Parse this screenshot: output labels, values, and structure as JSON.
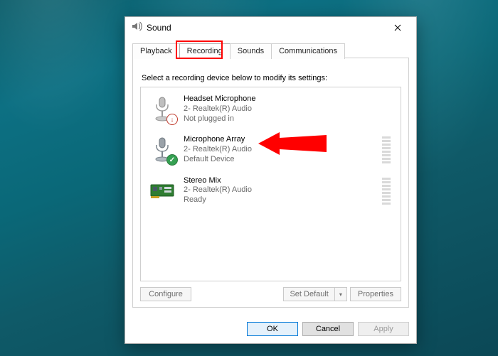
{
  "window": {
    "title": "Sound"
  },
  "tabs": {
    "items": [
      {
        "label": "Playback"
      },
      {
        "label": "Recording"
      },
      {
        "label": "Sounds"
      },
      {
        "label": "Communications"
      }
    ],
    "active_index": 1
  },
  "instruction": "Select a recording device below to modify its settings:",
  "devices": [
    {
      "name": "Headset Microphone",
      "desc": "2- Realtek(R) Audio",
      "status": "Not plugged in",
      "icon": "mic-icon",
      "badge": "error",
      "meter": false
    },
    {
      "name": "Microphone Array",
      "desc": "2- Realtek(R) Audio",
      "status": "Default Device",
      "icon": "mic-icon",
      "badge": "ok",
      "meter": true
    },
    {
      "name": "Stereo Mix",
      "desc": "2- Realtek(R) Audio",
      "status": "Ready",
      "icon": "card-icon",
      "badge": null,
      "meter": true
    }
  ],
  "actions": {
    "configure": "Configure",
    "set_default_main": "Set Default",
    "properties": "Properties"
  },
  "footer": {
    "ok": "OK",
    "cancel": "Cancel",
    "apply": "Apply"
  },
  "dropdown_glyph": "▾"
}
